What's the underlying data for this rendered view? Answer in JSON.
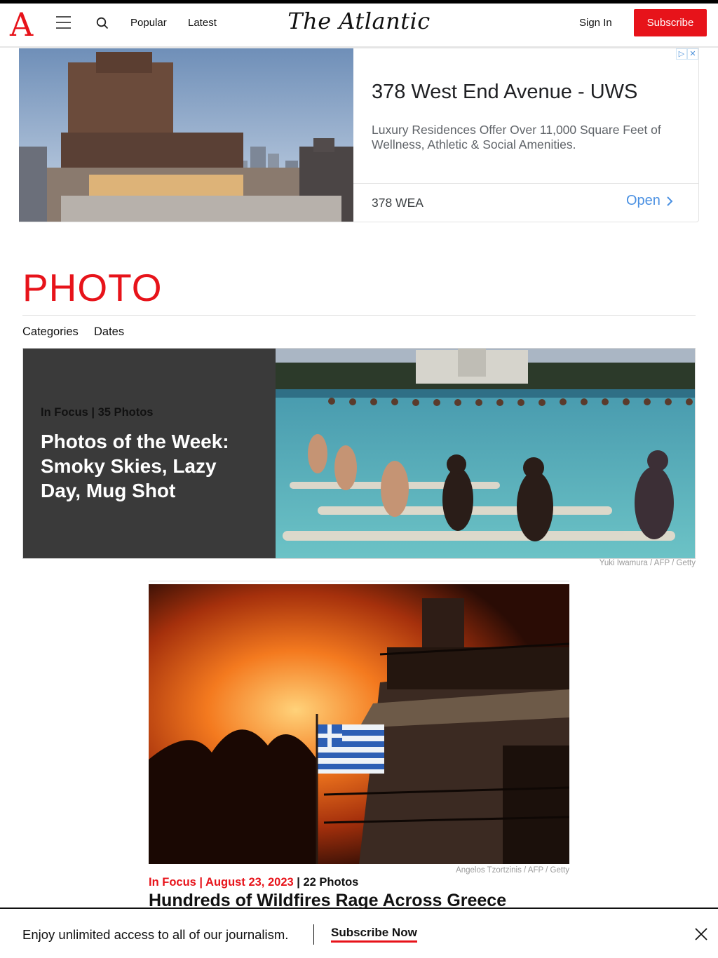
{
  "header": {
    "logo_letter": "A",
    "brand": "The Atlantic",
    "nav": {
      "popular": "Popular",
      "latest": "Latest"
    },
    "sign_in": "Sign In",
    "subscribe": "Subscribe",
    "accent_color": "#e7131a"
  },
  "ad": {
    "title": "378 West End Avenue - UWS",
    "description": "Luxury Residences Offer Over 11,000 Square Feet of Wellness, Athletic & Social Amenities.",
    "advertiser": "378 WEA",
    "cta": "Open",
    "icons": [
      "adchoices-icon",
      "close-icon"
    ]
  },
  "section": {
    "title": "PHOTO",
    "subnav": {
      "categories": "Categories",
      "dates": "Dates"
    }
  },
  "hero": {
    "kicker": "In Focus | 35 Photos",
    "headline": "Photos of the Week: Smoky Skies, Lazy Day, Mug Shot",
    "credit": "Yuki Iwamura / AFP / Getty"
  },
  "story": {
    "section": "In Focus",
    "date": "August 23, 2023",
    "photo_count": "22 Photos",
    "headline": "Hundreds of Wildfires Rage Across Greece",
    "credit": "Angelos Tzortzinis / AFP / Getty"
  },
  "banner": {
    "text": "Enjoy unlimited access to all of our journalism.",
    "cta": "Subscribe Now"
  }
}
